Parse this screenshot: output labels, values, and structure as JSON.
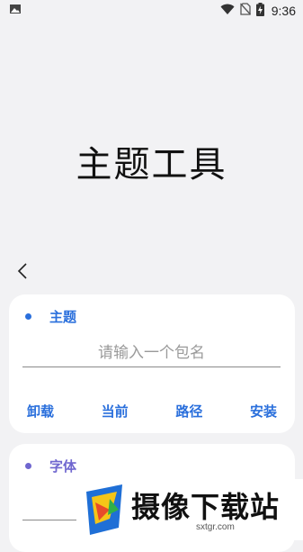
{
  "status_bar": {
    "time": "9:36",
    "icons": [
      "image-icon",
      "wifi-icon",
      "no-sim-icon",
      "battery-charging-icon"
    ]
  },
  "app": {
    "title": "主题工具"
  },
  "theme_card": {
    "label": "主题",
    "accent": "#2a6fdc",
    "input_placeholder": "请输入一个包名",
    "input_value": "",
    "actions": [
      "卸载",
      "当前",
      "路径",
      "安装"
    ]
  },
  "font_card": {
    "label": "字体",
    "accent": "#6f66cf"
  },
  "watermark": {
    "text": "摄像下载站",
    "subtext": "sxtgr.com"
  }
}
